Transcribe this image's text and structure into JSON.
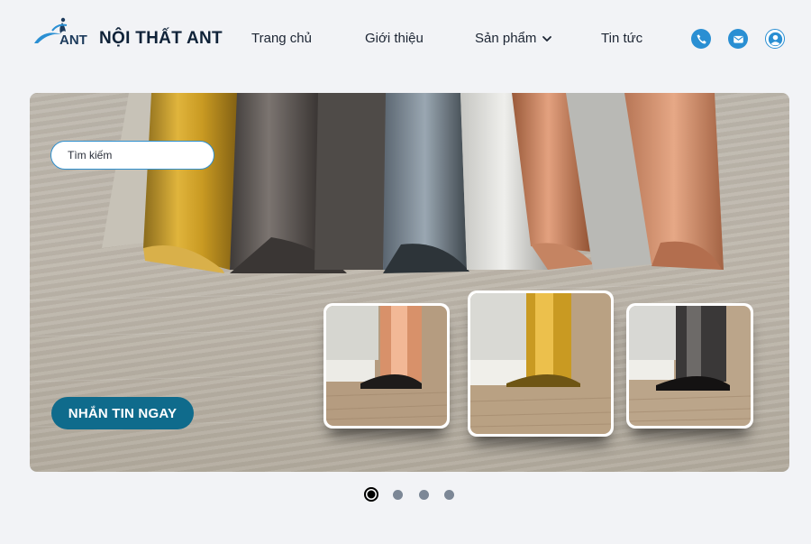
{
  "brand": {
    "name": "NỘI THẤT ANT",
    "logo_text": "ANT"
  },
  "nav": {
    "home": "Trang chủ",
    "about": "Giới thiệu",
    "products": "Sản phẩm",
    "news": "Tin tức"
  },
  "header_icons": [
    "phone-icon",
    "mail-icon",
    "user-icon"
  ],
  "search": {
    "placeholder": "Tìm kiếm"
  },
  "hero": {
    "cta_label": "NHẮN TIN NGAY",
    "thumbnails": [
      "copper-profile",
      "gold-profile",
      "black-profile"
    ]
  },
  "carousel": {
    "slide_count": 4,
    "active_index": 0
  },
  "colors": {
    "primary": "#0f6b8c",
    "accent": "#2a8fd3",
    "brand_text": "#0f2238",
    "background": "#f2f3f6"
  }
}
